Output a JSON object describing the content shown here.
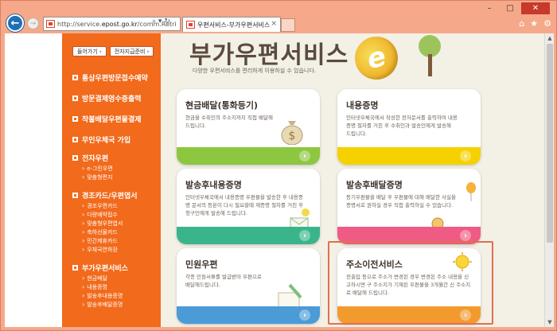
{
  "browser": {
    "url_prefix": "http://service.",
    "url_host": "epost.go.kr",
    "url_rest": "/comm.Retri",
    "tab_title": "우편서비스-부가우편서비스",
    "tab_close": "×"
  },
  "sidebar": {
    "top_buttons": [
      "들어가기",
      "전자지급준비"
    ],
    "main_items": [
      {
        "label": "통상우편방문접수예약"
      },
      {
        "label": "방문결제영수증출력"
      },
      {
        "label": "착불배달우편물결제"
      },
      {
        "label": "무인우체국 가입"
      }
    ],
    "groups": [
      {
        "label": "전자우편",
        "subs": [
          "e-그린우편",
          "맞춤형편지"
        ]
      },
      {
        "label": "경조카드/우편엽서",
        "subs": [
          "경조우편카드",
          "다량예약접수",
          "맞춤형우편엽서",
          "축하선물카드",
          "민간제휴카드",
          "우체국연하장"
        ]
      },
      {
        "label": "부가우편서비스",
        "subs": [
          "현금배달",
          "내용증명",
          "발송후내용증명",
          "발송후배달증명"
        ]
      }
    ]
  },
  "content": {
    "title": "부가우편서비스",
    "subtitle": "다양한 우편서비스를 편리하게 이용하실 수 있습니다.",
    "deco_letter": "e",
    "cards": [
      {
        "title": "현금배달(통화등기)",
        "desc": "현금을 수취인의 주소지까지 직접 배달해드립니다.",
        "band": "green",
        "arrow": "›"
      },
      {
        "title": "내용증명",
        "desc": "인터넷우체국에서 작성한 전자문서를 출력하여 내용증명 절차를 거친 후 수취인과 발송인에게 발송해 드립니다.",
        "band": "yellow",
        "arrow": "›"
      },
      {
        "title": "발송후내용증명",
        "desc": "인터넷우체국에서 내용증명 우편물을 발송한 후 내용증명 문서의 등본이 다시 필요할때 재증명 절차를 거친 후 청구인에게 발송해 드립니다.",
        "band": "teal",
        "arrow": "›"
      },
      {
        "title": "발송후배달증명",
        "desc": "등기우편물을 배달 후 우편물에 대해 배달한 사실을 증명서로 원하실 경우 직접 출력하실 수 있습니다.",
        "band": "pink",
        "arrow": "›"
      },
      {
        "title": "민원우편",
        "desc": "각종 민원서류를 발급받아 우편으로 배달해드립니다.",
        "band": "blue",
        "arrow": "›"
      },
      {
        "title": "주소이전서비스",
        "desc": "전출입 등으로 주소가 변경된 경우 변경된 주소 내용을 신고하시면 구 주소지가 기재된 우편물을 3개월간 신 주소지로 배달해 드립니다.",
        "band": "orange",
        "arrow": "›"
      }
    ]
  },
  "icons": {
    "back": "back-arrow-icon",
    "forward": "forward-arrow-icon",
    "home": "home-icon",
    "star": "star-icon",
    "gear": "gear-icon"
  },
  "colors": {
    "sidebar": "#f26a1b",
    "frame": "#f6a98a",
    "content_bg": "#f3f0e6"
  }
}
